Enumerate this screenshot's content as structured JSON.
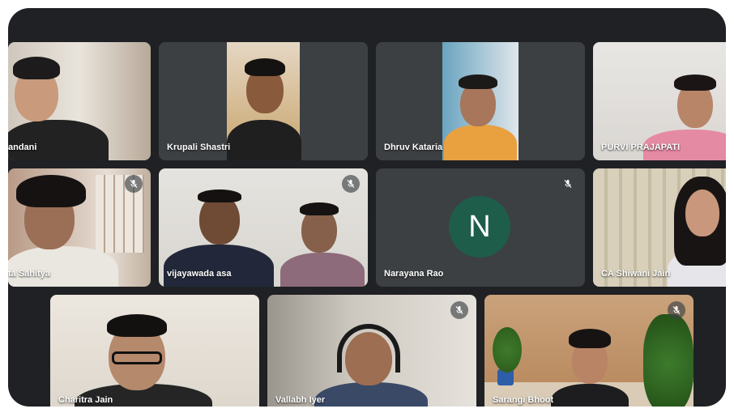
{
  "meeting": {
    "participants": [
      {
        "name": "andani",
        "muted": false
      },
      {
        "name": "Krupali Shastri",
        "muted": false
      },
      {
        "name": "Dhruv Kataria",
        "muted": false
      },
      {
        "name": "PURVI PRAJAPATI",
        "muted": false
      },
      {
        "name": "ta Sahitya",
        "muted": true
      },
      {
        "name": "vijayawada",
        "name_suffix": "asa",
        "muted": true
      },
      {
        "name": "Narayana Rao",
        "muted": true,
        "avatar_letter": "N"
      },
      {
        "name": "CA Shiwani Jain",
        "muted": false,
        "speaking": true
      },
      {
        "name": "Charitra Jain",
        "muted": false
      },
      {
        "name": "Vallabh Iyer",
        "muted": true
      },
      {
        "name": "Sarangi Bhoot",
        "muted": true
      }
    ]
  },
  "colors": {
    "window_bg": "#202124",
    "tile_bg": "#3c4043",
    "avatar_bg": "#1e5d4a",
    "active_outline": "#8ab4f8"
  },
  "icons": {
    "muted": "mic-off-icon"
  }
}
